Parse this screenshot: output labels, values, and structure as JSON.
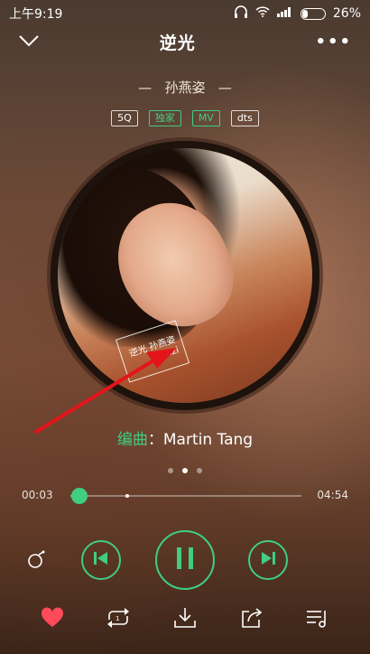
{
  "status_bar": {
    "time": "上午9:19",
    "battery_percent": "26%",
    "battery_level": 0.26
  },
  "header": {
    "title": "逆光",
    "back_icon": "chevron-down-icon",
    "more_icon": "more-dots-icon",
    "more_label": "•••"
  },
  "artist": {
    "name": "孙燕姿",
    "decoration": "—"
  },
  "tags": [
    "5Q",
    "独家",
    "MV",
    "dts"
  ],
  "album_art": {
    "logo_text": "逆光 孙燕姿 yanzi"
  },
  "composer": {
    "label": "编曲",
    "separator": "：",
    "name": "Martin Tang"
  },
  "page_indicator": {
    "count": 3,
    "active_index": 1
  },
  "progress": {
    "current": "00:03",
    "total": "04:54",
    "played_fraction": 0.04,
    "buffered_fraction": 0.24
  },
  "controls": {
    "mode_icon": "play-mode-icon",
    "prev_icon": "skip-previous-icon",
    "play_pause_icon": "pause-icon",
    "next_icon": "skip-next-icon"
  },
  "bottom_bar": {
    "icons": [
      "heart-icon",
      "repeat-icon",
      "download-icon",
      "share-icon",
      "playlist-icon"
    ]
  },
  "colors": {
    "accent": "#3fce82",
    "heart": "#ff4a5a",
    "arrow": "#e3151a"
  }
}
